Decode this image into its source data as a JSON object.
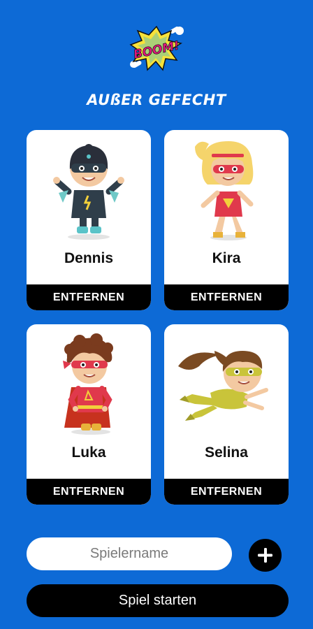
{
  "logo": {
    "text": "BOOM!"
  },
  "title": "AUßER GEFECHT",
  "players": [
    {
      "name": "Dennis",
      "remove_label": "ENTFERNEN",
      "avatar": "hero-boy-dark-mask"
    },
    {
      "name": "Kira",
      "remove_label": "ENTFERNEN",
      "avatar": "hero-girl-blonde"
    },
    {
      "name": "Luka",
      "remove_label": "ENTFERNEN",
      "avatar": "hero-boy-red-cape"
    },
    {
      "name": "Selina",
      "remove_label": "ENTFERNEN",
      "avatar": "hero-girl-flying"
    }
  ],
  "player_input": {
    "placeholder": "Spielername",
    "value": ""
  },
  "add_button": {
    "icon": "plus-icon"
  },
  "start_button": {
    "label": "Spiel starten"
  },
  "colors": {
    "background": "#0d6ad6",
    "card": "#ffffff",
    "button": "#000000",
    "logo_burst": "#f7e23b",
    "logo_text": "#e7167f"
  }
}
